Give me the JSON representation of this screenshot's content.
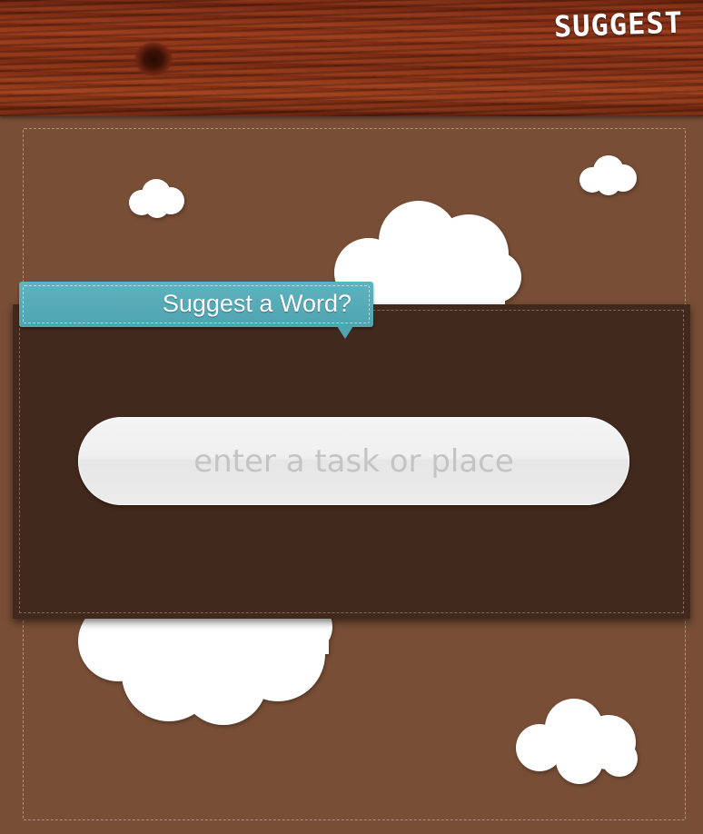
{
  "header": {
    "title": "SUGGEST"
  },
  "form": {
    "tag_label": "Suggest a Word?",
    "input_placeholder": "enter a task or place",
    "input_value": ""
  },
  "colors": {
    "background": "#784e36",
    "panel": "#42291d",
    "tag": "#5fb3bf",
    "wood": "#8e3418"
  },
  "icons": [
    "cloud-icon"
  ]
}
